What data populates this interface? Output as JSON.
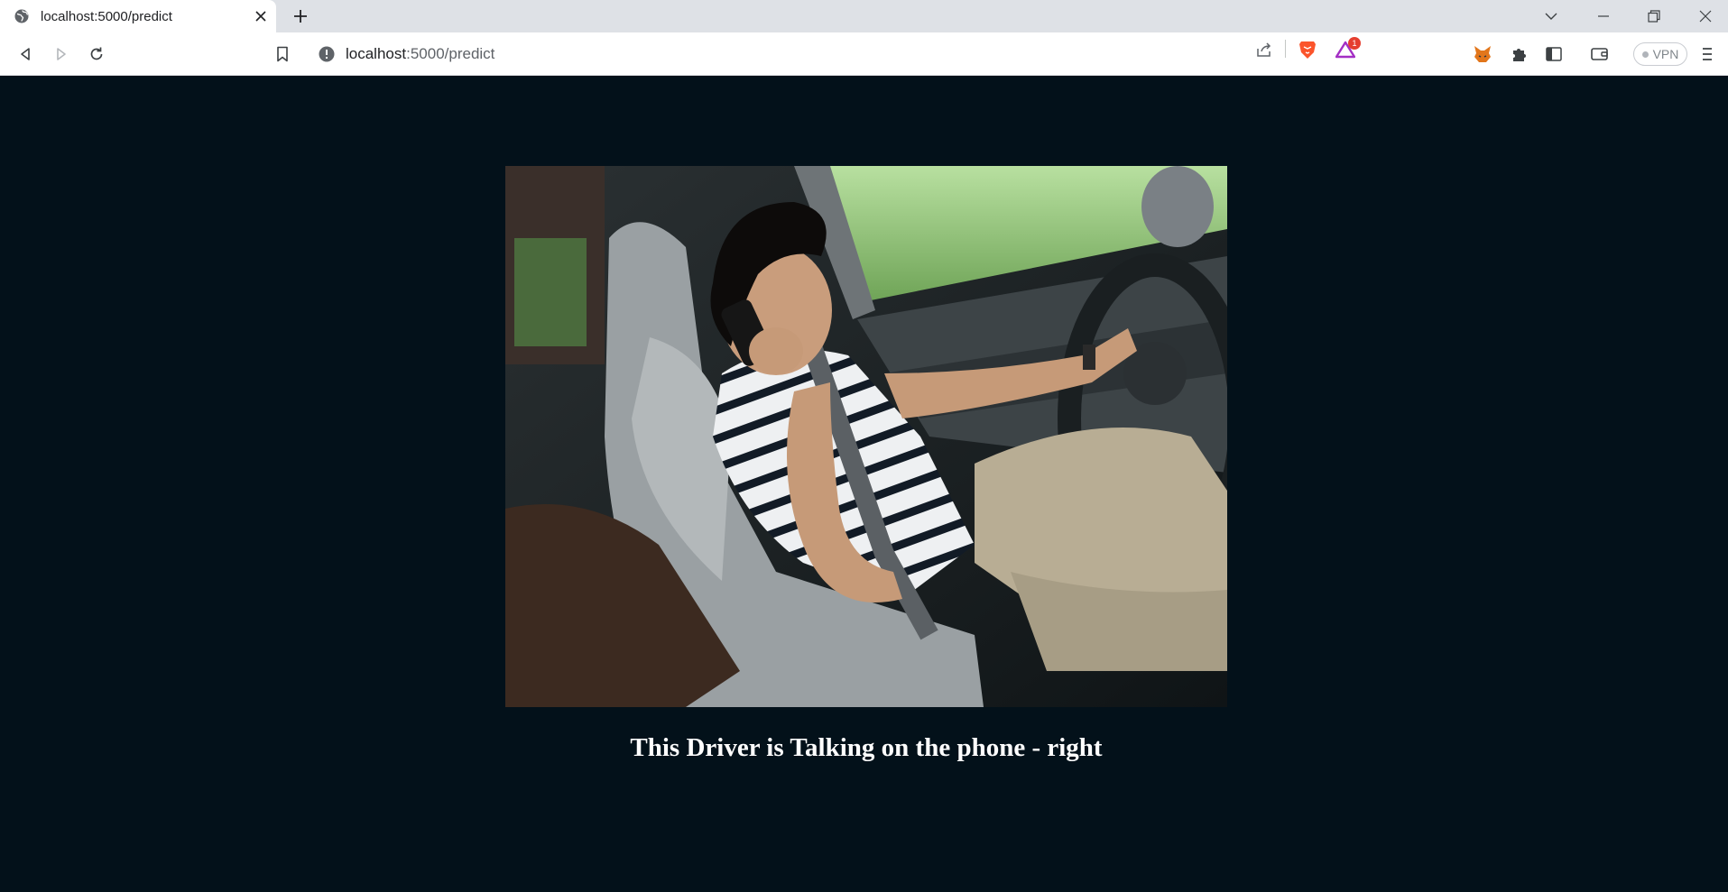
{
  "browser": {
    "tab": {
      "title": "localhost:5000/predict"
    },
    "address": {
      "host": "localhost",
      "path": ":5000/predict"
    },
    "rewards_badge": "1",
    "vpn_label": "VPN"
  },
  "page": {
    "prediction_text": "This Driver is Talking on the phone - right"
  },
  "colors": {
    "page_background": "#03111a",
    "text": "#ffffff",
    "brave_orange": "#fb542b"
  },
  "icons": {
    "tab_favicon": "globe-icon",
    "tab_close": "close-icon",
    "new_tab": "plus-icon",
    "back": "back-arrow-icon",
    "forward": "forward-arrow-icon",
    "reload": "reload-icon",
    "bookmark": "bookmark-icon",
    "site_info": "info-circle-icon",
    "share": "share-icon",
    "brave_shields": "brave-lion-icon",
    "brave_rewards": "rewards-triangle-icon",
    "wallet_extension": "fox-icon",
    "extensions": "puzzle-icon",
    "sidebar": "sidebar-icon",
    "wallet": "wallet-icon",
    "menu": "hamburger-menu-icon",
    "tab_search": "chevron-down-icon",
    "minimize": "minimize-icon",
    "restore": "restore-icon",
    "close_window": "close-window-icon"
  }
}
